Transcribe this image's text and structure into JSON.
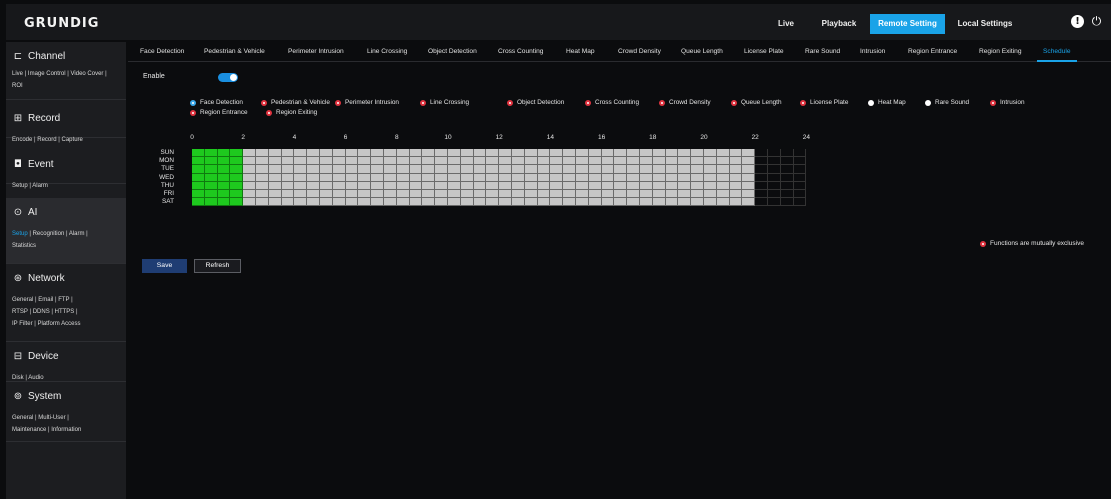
{
  "brand": "GRUNDIG",
  "topnav": [
    "Live",
    "Playback",
    "Remote Setting",
    "Local Settings"
  ],
  "topnav_active": "Remote Setting",
  "accent": "#1aa3e8",
  "sidebar": [
    {
      "title": "Channel",
      "icon": "camera-icon",
      "links": [
        "Live",
        "Image Control",
        "Video Cover",
        "ROI"
      ]
    },
    {
      "title": "Record",
      "icon": "record-icon",
      "links": [
        "Encode",
        "Record",
        "Capture"
      ]
    },
    {
      "title": "Event",
      "icon": "event-icon",
      "links": [
        "Setup",
        "Alarm"
      ]
    },
    {
      "title": "AI",
      "icon": "ai-icon",
      "links": [
        "Setup",
        "Recognition",
        "Alarm",
        "Statistics"
      ],
      "selected": "Setup"
    },
    {
      "title": "Network",
      "icon": "network-icon",
      "links": [
        "General",
        "Email",
        "FTP",
        "RTSP",
        "DDNS",
        "HTTPS",
        "IP Filter",
        "Platform Access"
      ]
    },
    {
      "title": "Device",
      "icon": "device-icon",
      "links": [
        "Disk",
        "Audio"
      ]
    },
    {
      "title": "System",
      "icon": "system-icon",
      "links": [
        "General",
        "Multi-User",
        "Maintenance",
        "Information"
      ]
    }
  ],
  "tabs": [
    "Face Detection",
    "Pedestrian & Vehicle",
    "Perimeter Intrusion",
    "Line Crossing",
    "Object Detection",
    "Cross Counting",
    "Heat Map",
    "Crowd Density",
    "Queue Length",
    "License Plate",
    "Rare Sound",
    "Intrusion",
    "Region Entrance",
    "Region Exiting",
    "Schedule"
  ],
  "active_tab": "Schedule",
  "enable_label": "Enable",
  "enable_on": true,
  "detection_types": [
    {
      "label": "Face Detection",
      "state": "selected"
    },
    {
      "label": "Pedestrian & Vehicle",
      "state": "exclusive"
    },
    {
      "label": "Perimeter Intrusion",
      "state": "exclusive"
    },
    {
      "label": "Line Crossing",
      "state": "exclusive"
    },
    {
      "label": "Object Detection",
      "state": "exclusive"
    },
    {
      "label": "Cross Counting",
      "state": "exclusive"
    },
    {
      "label": "Crowd Density",
      "state": "exclusive"
    },
    {
      "label": "Queue Length",
      "state": "exclusive"
    },
    {
      "label": "License Plate",
      "state": "exclusive"
    },
    {
      "label": "Heat Map",
      "state": "available"
    },
    {
      "label": "Rare Sound",
      "state": "available"
    },
    {
      "label": "Intrusion",
      "state": "exclusive"
    },
    {
      "label": "Region Entrance",
      "state": "exclusive"
    },
    {
      "label": "Region Exiting",
      "state": "exclusive"
    }
  ],
  "hours": [
    "0",
    "2",
    "4",
    "6",
    "8",
    "10",
    "12",
    "14",
    "16",
    "18",
    "20",
    "22",
    "24"
  ],
  "days": [
    "SUN",
    "MON",
    "TUE",
    "WED",
    "THU",
    "FRI",
    "SAT"
  ],
  "schedule": {
    "enabled_hours": [
      0,
      1
    ],
    "total_hours": 24,
    "note": "Functions are mutually exclusive"
  },
  "buttons": {
    "save": "Save",
    "refresh": "Refresh"
  }
}
